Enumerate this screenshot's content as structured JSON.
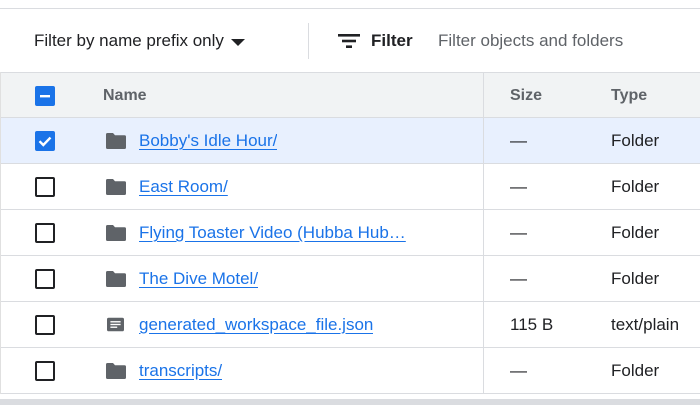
{
  "filter_bar": {
    "prefix_label": "Filter by name prefix only",
    "filter_label": "Filter",
    "filter_placeholder": "Filter objects and folders"
  },
  "table": {
    "headers": {
      "name": "Name",
      "size": "Size",
      "type": "Type"
    },
    "rows": [
      {
        "name": "Bobby's Idle Hour/",
        "size": "—",
        "type": "Folder",
        "icon": "folder-icon",
        "checked": true
      },
      {
        "name": "East Room/",
        "size": "—",
        "type": "Folder",
        "icon": "folder-icon",
        "checked": false
      },
      {
        "name": "Flying Toaster Video (Hubba Hub…",
        "size": "—",
        "type": "Folder",
        "icon": "folder-icon",
        "checked": false
      },
      {
        "name": "The Dive Motel/",
        "size": "—",
        "type": "Folder",
        "icon": "folder-icon",
        "checked": false
      },
      {
        "name": "generated_workspace_file.json",
        "size": "115 B",
        "type": "text/plain",
        "icon": "file-icon",
        "checked": false
      },
      {
        "name": "transcripts/",
        "size": "—",
        "type": "Folder",
        "icon": "folder-icon",
        "checked": false
      }
    ]
  },
  "colors": {
    "accent": "#1a73e8",
    "selected_row": "#e8f0fe",
    "header_bg": "#f1f3f4"
  }
}
